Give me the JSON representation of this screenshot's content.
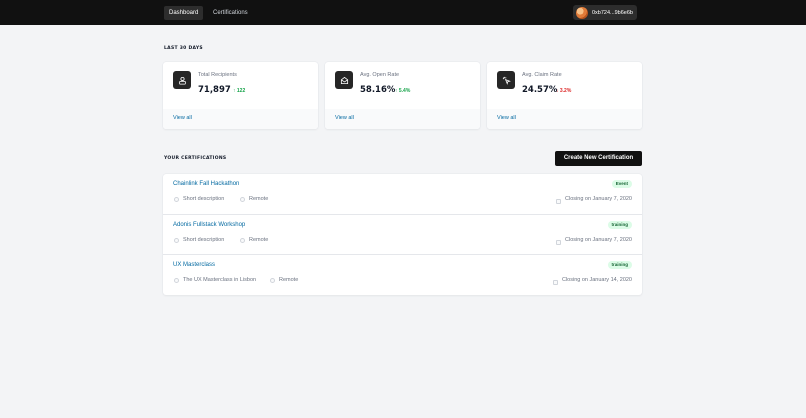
{
  "nav": {
    "dashboard_label": "Dashboard",
    "certifications_label": "Certifications",
    "wallet_address": "0xb724...9b6e6b"
  },
  "stats": {
    "section_title": "LAST 30 DAYS",
    "cards": [
      {
        "label": "Total Recipients",
        "value": "71,897",
        "delta": "122",
        "trend": "up",
        "link": "View all",
        "icon": "user-badge-icon"
      },
      {
        "label": "Avg. Open Rate",
        "value": "58.16%",
        "delta": "5.4%",
        "trend": "up",
        "link": "View all",
        "icon": "envelope-open-icon"
      },
      {
        "label": "Avg. Claim Rate",
        "value": "24.57%",
        "delta": "3.2%",
        "trend": "down",
        "link": "View all",
        "icon": "cursor-click-icon"
      }
    ]
  },
  "certifications": {
    "section_title": "YOUR CERTIFICATIONS",
    "create_button_label": "Create New Certification",
    "items": [
      {
        "title": "Chainlink Fall Hackathon",
        "badge": "Event",
        "description": "Short description",
        "location": "Remote",
        "closing": "Closing on January 7, 2020"
      },
      {
        "title": "Adonis Fullstack Workshop",
        "badge": "training",
        "description": "Short description",
        "location": "Remote",
        "closing": "Closing on January 7, 2020"
      },
      {
        "title": "UX Masterclass",
        "badge": "training",
        "description": "The UX Masterclass in Lisbon",
        "location": "Remote",
        "closing": "Closing on January 14, 2020"
      }
    ]
  },
  "colors": {
    "topbar": "#111111",
    "link": "#0369a1",
    "positive": "#16a34a",
    "negative": "#dc2626",
    "badge_bg": "#dcfce7",
    "badge_text": "#166534"
  }
}
